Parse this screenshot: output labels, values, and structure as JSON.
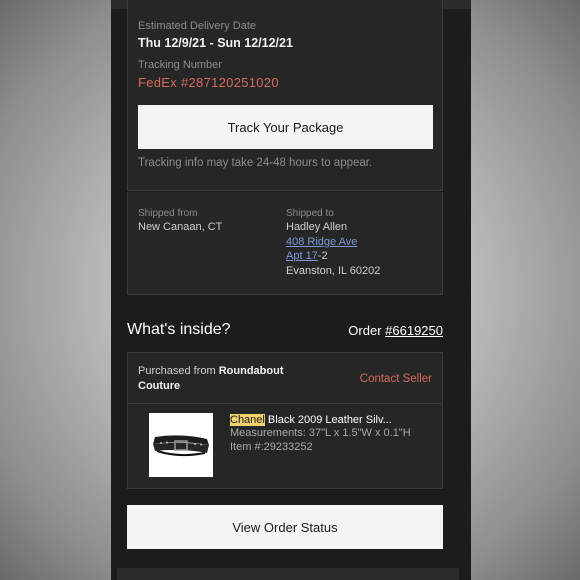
{
  "delivery": {
    "estimated_label": "Estimated Delivery Date",
    "estimated_dates": "Thu 12/9/21 - Sun 12/12/21",
    "tracking_label": "Tracking Number",
    "tracking_value": "FedEx #287120251020",
    "track_button": "Track Your Package",
    "tracking_note": "Tracking info may take 24-48 hours to appear."
  },
  "shipping": {
    "from_label": "Shipped from",
    "from_value": "New Canaan, CT",
    "to_label": "Shipped to",
    "to_name": "Hadley Allen",
    "to_street": "408 Ridge Ave",
    "to_apt_link": "Apt 17",
    "to_apt_suffix": "-2",
    "to_city": "Evanston, IL 60202"
  },
  "inside": {
    "title": "What's inside?",
    "order_label": "Order",
    "order_number": "#6619250",
    "purchased_from_prefix": "Purchased from",
    "seller_name": "Roundabout Couture",
    "contact_seller": "Contact Seller",
    "item": {
      "brand": "Chanel",
      "title_rest": "Black 2009 Leather Silv...",
      "measurements": "Measurements: 37\"L x 1.5\"W x 0.1\"H",
      "item_number": "Item #:29233252",
      "thumbnail_icon": "belt-image"
    }
  },
  "actions": {
    "view_order_status": "View Order Status"
  }
}
